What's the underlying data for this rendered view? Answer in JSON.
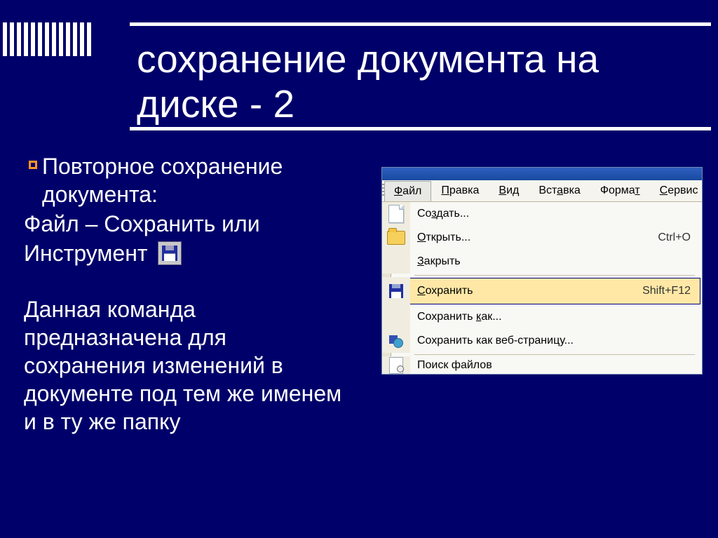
{
  "title": "сохранение документа на диске - 2",
  "bullet_main": "Повторное сохранение документа:",
  "line_file_save": "Файл – Сохранить или",
  "line_instrument": "Инструмент",
  "paragraph": "Данная команда предназначена для сохранения изменений в документе под тем же именем и в ту же папку",
  "word": {
    "menu": {
      "file": "Файл",
      "file_u": "Ф",
      "edit": "Правка",
      "edit_u": "П",
      "view": "Вид",
      "view_u": "В",
      "insert": "Вставка",
      "insert_u": "а",
      "insert_pre": "Вст",
      "insert_post": "вка",
      "format": "Формат",
      "format_u": "т",
      "format_pre": "Форма",
      "service": "Сервис",
      "service_u": "С",
      "service_post": "ервис"
    },
    "dropdown": {
      "new": "Создать...",
      "new_u": "з",
      "new_pre": "Со",
      "new_post": "дать...",
      "open": "Открыть...",
      "open_u": "О",
      "open_post": "ткрыть...",
      "open_short": "Ctrl+O",
      "close": "Закрыть",
      "close_u": "З",
      "close_post": "акрыть",
      "save": "Сохранить",
      "save_u": "С",
      "save_post": "охранить",
      "save_short": "Shift+F12",
      "saveas": "Сохранить как...",
      "saveas_u": "к",
      "saveas_pre": "Сохранить ",
      "saveas_post": "ак...",
      "saveweb": "Сохранить как веб-страницу...",
      "search_files": "Поиск файлов"
    }
  }
}
